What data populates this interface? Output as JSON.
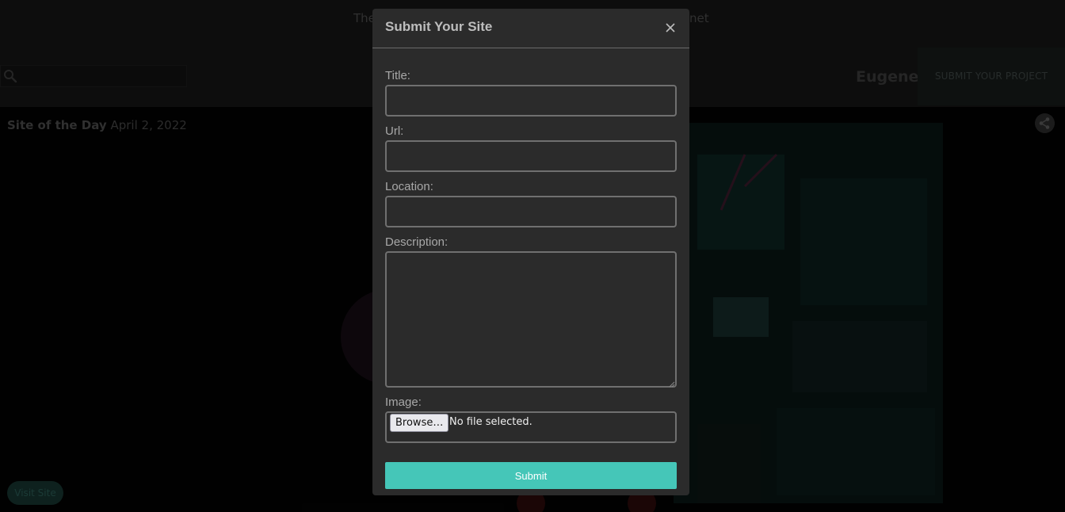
{
  "background": {
    "tagline": "The",
    "tagline_tail": "net",
    "brand": "Eugene",
    "submit_project_label": "SUBMIT YOUR PROJECT",
    "site_of_day_label": "Site of the Day",
    "site_of_day_date": "April 2, 2022",
    "visit_site_label": "Visit Site"
  },
  "modal": {
    "title": "Submit Your Site",
    "fields": [
      {
        "label": "Title:",
        "value": ""
      },
      {
        "label": "Url:",
        "value": ""
      },
      {
        "label": "Location:",
        "value": ""
      },
      {
        "label": "Description:",
        "value": ""
      },
      {
        "label": "Image:"
      }
    ],
    "browse_label": "Browse…",
    "file_status": "No file selected.",
    "submit_label": "Submit"
  },
  "colors": {
    "accent": "#45c6b8",
    "modal_bg": "#2b2b2b"
  },
  "icons": {
    "search": "search-icon",
    "share": "share-icon",
    "close": "close-icon"
  }
}
